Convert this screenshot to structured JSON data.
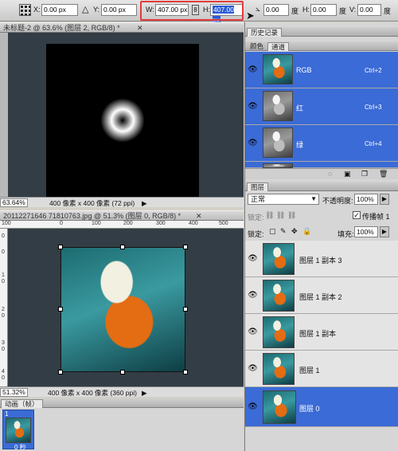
{
  "options_bar": {
    "x_label": "X:",
    "x_value": "0.00 px",
    "y_label": "Y:",
    "y_value": "0.00 px",
    "w_label": "W:",
    "w_value": "407.00 px",
    "h_label": "H:",
    "h_value": "407.00 px",
    "rot_value": "0.00",
    "rot_unit": "度",
    "hskew_label": "H:",
    "hskew_value": "0.00",
    "hskew_unit": "度",
    "vskew_label": "V:",
    "vskew_value": "0.00",
    "vskew_unit": "度"
  },
  "doc1": {
    "title": "未标题-2 @ 63.6% (图层 2, RGB/8) *",
    "zoom": "63.64%",
    "info": "400 像素 x 400 像素 (72 ppi)"
  },
  "doc2": {
    "title": "20112271646 71810763.jpg @ 51.3% (图层 0, RGB/8) *",
    "zoom": "51.32%",
    "info": "400 像素 x 400 像素 (360 ppi)",
    "ruler_h": [
      "100",
      "0",
      "100",
      "200",
      "300",
      "400",
      "500"
    ],
    "ruler_v": [
      "0",
      "0",
      "1",
      "0",
      "2",
      "0",
      "3",
      "0",
      "4",
      "0",
      "0"
    ]
  },
  "history_panel": {
    "tab_history": "历史记录"
  },
  "channels_panel": {
    "tab_color": "颜色",
    "tab_channels": "通道",
    "channels": [
      {
        "name": "RGB",
        "shortcut": "Ctrl+2"
      },
      {
        "name": "红",
        "shortcut": "Ctrl+3"
      },
      {
        "name": "绿",
        "shortcut": "Ctrl+4"
      }
    ]
  },
  "layers_panel": {
    "tab": "图层",
    "blend_mode": "正常",
    "opacity_label": "不透明度:",
    "opacity_value": "100%",
    "lock_label": "锁定:",
    "propagate_label": "传播帧 1",
    "fill_label": "填充:",
    "fill_value": "100%",
    "layers": [
      {
        "name": "图层 1 副本 3"
      },
      {
        "name": "图层 1 副本 2"
      },
      {
        "name": "图层 1 副本"
      },
      {
        "name": "图层 1"
      },
      {
        "name": "图层 0"
      }
    ]
  },
  "animation_panel": {
    "title": "动画（帧）",
    "frame_number": "1",
    "frame_time": "0 秒"
  },
  "colors": {
    "accent": "#3b6bd6",
    "highlight_box": "#e23b3b",
    "canvas": "#333d45"
  }
}
